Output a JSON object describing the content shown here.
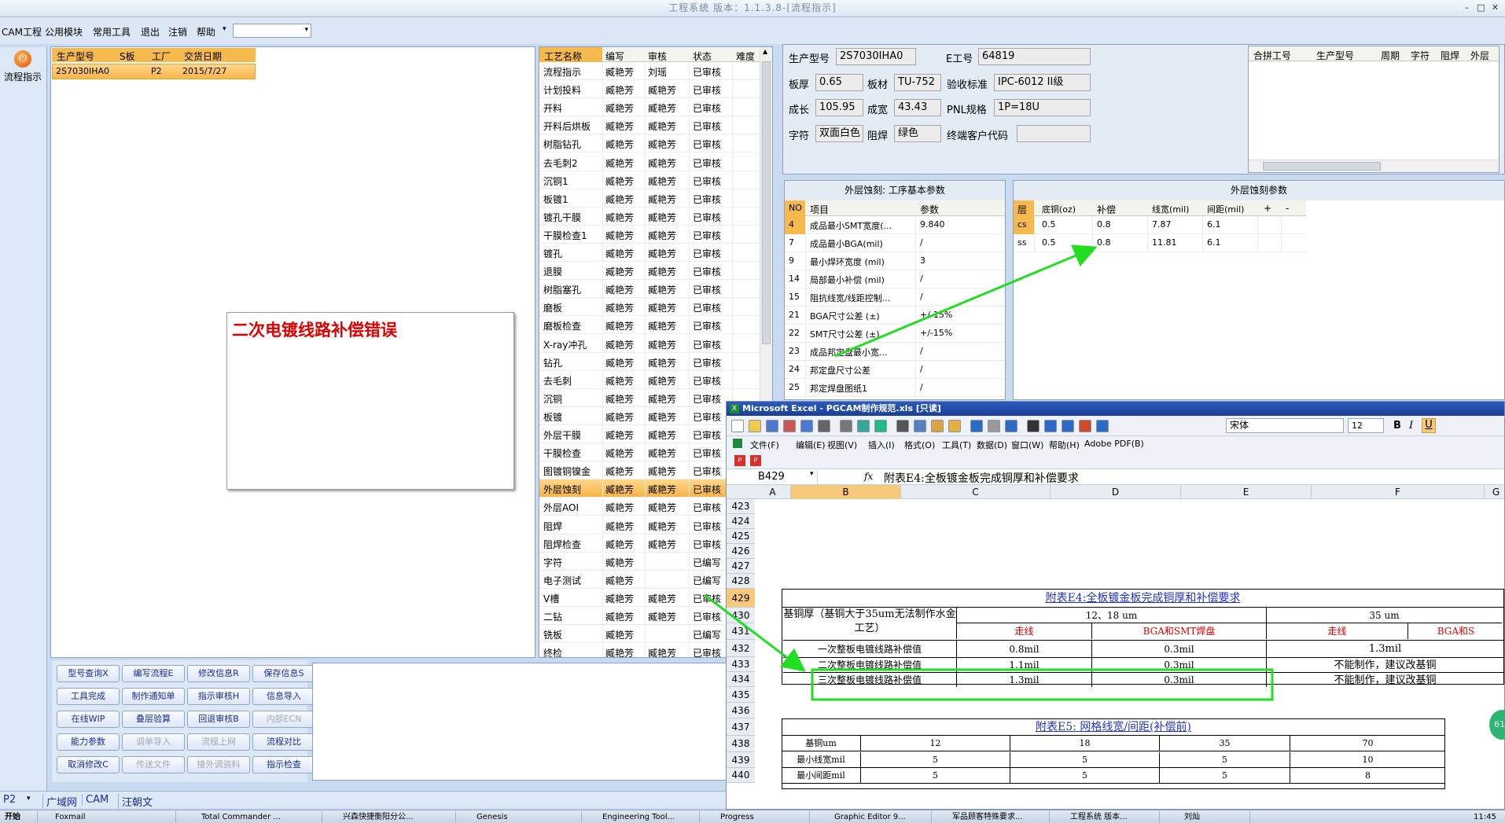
{
  "title": "工程系统 版本：1.1.3.8-[流程指示]",
  "menu": {
    "items": [
      "CAM工程",
      "公用模块",
      "常用工具",
      "退出",
      "注销",
      "帮助"
    ],
    "help_arrow": "▾"
  },
  "leftnav": {
    "flow_label": "流程指示"
  },
  "orders": {
    "headers": [
      "生产型号",
      "S板",
      "工厂",
      "交货日期"
    ],
    "row": [
      "2S7030IHA0",
      "",
      "P2",
      "2015/7/27"
    ]
  },
  "note": {
    "text": "二次电镀线路补偿错误"
  },
  "process": {
    "headers": [
      "工艺名称",
      "编写",
      "审核",
      "状态",
      "难度"
    ],
    "rows": [
      [
        "流程指示",
        "臧艳芳",
        "刘瑶",
        "已审核"
      ],
      [
        "计划投料",
        "臧艳芳",
        "臧艳芳",
        "已审核"
      ],
      [
        "开料",
        "臧艳芳",
        "臧艳芳",
        "已审核"
      ],
      [
        "开料后烘板",
        "臧艳芳",
        "臧艳芳",
        "已审核"
      ],
      [
        "树脂钻孔",
        "臧艳芳",
        "臧艳芳",
        "已审核"
      ],
      [
        "去毛刺2",
        "臧艳芳",
        "臧艳芳",
        "已审核"
      ],
      [
        "沉铜1",
        "臧艳芳",
        "臧艳芳",
        "已审核"
      ],
      [
        "板镀1",
        "臧艳芳",
        "臧艳芳",
        "已审核"
      ],
      [
        "镀孔干膜",
        "臧艳芳",
        "臧艳芳",
        "已审核"
      ],
      [
        "干膜检查1",
        "臧艳芳",
        "臧艳芳",
        "已审核"
      ],
      [
        "镀孔",
        "臧艳芳",
        "臧艳芳",
        "已审核"
      ],
      [
        "退膜",
        "臧艳芳",
        "臧艳芳",
        "已审核"
      ],
      [
        "树脂塞孔",
        "臧艳芳",
        "臧艳芳",
        "已审核"
      ],
      [
        "磨板",
        "臧艳芳",
        "臧艳芳",
        "已审核"
      ],
      [
        "磨板检查",
        "臧艳芳",
        "臧艳芳",
        "已审核"
      ],
      [
        "X-ray冲孔",
        "臧艳芳",
        "臧艳芳",
        "已审核"
      ],
      [
        "钻孔",
        "臧艳芳",
        "臧艳芳",
        "已审核"
      ],
      [
        "去毛刺",
        "臧艳芳",
        "臧艳芳",
        "已审核"
      ],
      [
        "沉铜",
        "臧艳芳",
        "臧艳芳",
        "已审核"
      ],
      [
        "板镀",
        "臧艳芳",
        "臧艳芳",
        "已审核"
      ],
      [
        "外层干膜",
        "臧艳芳",
        "臧艳芳",
        "已审核"
      ],
      [
        "干膜检查",
        "臧艳芳",
        "臧艳芳",
        "已审核"
      ],
      [
        "图镀铜镍金",
        "臧艳芳",
        "臧艳芳",
        "已审核"
      ],
      [
        "外层蚀刻",
        "臧艳芳",
        "臧艳芳",
        "已审核"
      ],
      [
        "外层AOI",
        "臧艳芳",
        "臧艳芳",
        "已审核"
      ],
      [
        "阻焊",
        "臧艳芳",
        "臧艳芳",
        "已审核"
      ],
      [
        "阻焊检查",
        "臧艳芳",
        "臧艳芳",
        "已审核"
      ],
      [
        "字符",
        "臧艳芳",
        "",
        "已编写"
      ],
      [
        "电子测试",
        "臧艳芳",
        "",
        "已编写"
      ],
      [
        "V槽",
        "臧艳芳",
        "臧艳芳",
        "已审核"
      ],
      [
        "二钻",
        "臧艳芳",
        "臧艳芳",
        "已审核"
      ],
      [
        "铣板",
        "臧艳芳",
        "",
        "已编写"
      ],
      [
        "终检",
        "臧艳芳",
        "臧艳芳",
        "已审核"
      ]
    ],
    "selected_index": 23
  },
  "buttons": [
    [
      "型号查询X",
      "编写流程E",
      "修改信息R",
      "保存信息S"
    ],
    [
      "工具完成",
      "制作通知单",
      "指示审核H",
      "信息导入"
    ],
    [
      "在线WIP",
      "叠层验算",
      "回退审核B",
      "内部ECN"
    ],
    [
      "能力参数",
      "调单导入",
      "流程上网",
      "流程对比"
    ],
    [
      "取消修改C",
      "传送文件",
      "接外调资料",
      "指示检查"
    ]
  ],
  "disabled_buttons": [
    "内部ECN",
    "调单导入",
    "流程上网",
    "传送文件",
    "接外调资料"
  ],
  "info": {
    "labels": {
      "model": "生产型号",
      "eno": "E工号",
      "thick": "板厚",
      "mat": "板材",
      "std": "验收标准",
      "len": "成长",
      "wid": "成宽",
      "pnl": "PNL规格",
      "char": "字符",
      "mask": "阻焊",
      "cust": "终端客户代码"
    },
    "values": {
      "model": "2S7030IHA0",
      "eno": "64819",
      "thick": "0.65",
      "mat": "TU-752",
      "std": "IPC-6012 II级",
      "len": "105.95",
      "wid": "43.43",
      "pnl": "1P=18U",
      "char": "双面白色",
      "mask": "绿色",
      "cust": ""
    }
  },
  "merge": {
    "headers": [
      "合拼工号",
      "生产型号",
      "周期",
      "字符",
      "阻焊",
      "外层"
    ]
  },
  "etch_basic": {
    "title": "外层蚀刻: 工序基本参数",
    "headers": [
      "NO",
      "项目",
      "参数"
    ],
    "rows": [
      [
        "4",
        "成品最小SMT宽度(...",
        "9.840"
      ],
      [
        "7",
        "成品最小BGA(mil)",
        "/"
      ],
      [
        "9",
        "最小焊环宽度 (mil)",
        "3"
      ],
      [
        "14",
        "局部最小补偿 (mil)",
        "/"
      ],
      [
        "15",
        "阻抗线宽/线距控制...",
        "/"
      ],
      [
        "21",
        "BGA尺寸公差 (±)",
        "+/-15%"
      ],
      [
        "22",
        "SMT尺寸公差 (±)",
        "+/-15%"
      ],
      [
        "23",
        "成品邦定盘最小宽...",
        "/"
      ],
      [
        "24",
        "邦定盘尺寸公差",
        "/"
      ],
      [
        "25",
        "邦定焊盘图纸1",
        "/"
      ]
    ]
  },
  "etch_params": {
    "title": "外层蚀刻参数",
    "headers": [
      "层",
      "底铜(oz)",
      "补偿",
      "线宽(mil)",
      "间距(mil)",
      "+",
      "-"
    ],
    "rows": [
      [
        "cs",
        "0.5",
        "0.8",
        "7.87",
        "6.1"
      ],
      [
        "ss",
        "0.5",
        "0.8",
        "11.81",
        "6.1"
      ]
    ]
  },
  "excel": {
    "title": "Microsoft Excel - PGCAM制作规范.xls  [只读]",
    "menu": [
      "文件(F)",
      "编辑(E)",
      "视图(V)",
      "插入(I)",
      "格式(O)",
      "工具(T)",
      "数据(D)",
      "窗口(W)",
      "帮助(H)",
      "Adobe PDF(B)"
    ],
    "font": "宋体",
    "size": "12",
    "namebox": "B429",
    "fx": "fx",
    "formula": "附表E4:全板镀金板完成铜厚和补偿要求",
    "cols": [
      "A",
      "B",
      "C",
      "D",
      "E",
      "F",
      "G"
    ],
    "rownums": [
      "423",
      "424",
      "425",
      "426",
      "427",
      "428",
      "429",
      "430",
      "431",
      "432",
      "433",
      "434",
      "435",
      "436",
      "437",
      "438",
      "439",
      "440"
    ],
    "table1_title": "附表E4:全板镀金板完成铜厚和补偿要求",
    "base_cu": "基铜厚（基铜大于35um无法制作水金工艺）",
    "h12": "12、18 um",
    "h35": "35 um",
    "trace": "走线",
    "bga": "BGA和SMT焊盘",
    "trace2": "走线",
    "bga2": "BGA和S",
    "r1": [
      "一次整板电镀线路补偿值",
      "0.8mil",
      "0.3mil",
      "1.3mil"
    ],
    "r2": [
      "二次整板电镀线路补偿值",
      "1.1mil",
      "0.3mil",
      "不能制作，建议改基铜"
    ],
    "r3": [
      "三次整板电镀线路补偿值",
      "1.3mil",
      "0.3mil",
      "不能制作，建议改基铜"
    ],
    "table2_title": "附表E5: 网格线宽/间距(补偿前)",
    "t2_rows": [
      [
        "基铜um",
        "12",
        "18",
        "35",
        "70"
      ],
      [
        "最小线宽mil",
        "5",
        "5",
        "5",
        "10"
      ],
      [
        "最小间距mil",
        "5",
        "5",
        "5",
        "8"
      ]
    ]
  },
  "statusbar": {
    "factory": "P2",
    "items": [
      "广域网",
      "CAM",
      "汪朝文"
    ]
  },
  "badge": "61",
  "taskbar": {
    "start": "开始",
    "items": [
      "Foxmail",
      "Total Commander ...",
      "兴森快捷衡阳分公...",
      "Genesis",
      "Engineering Tool...",
      "Progress",
      "Graphic Editor 9...",
      "军品顾客特殊要求...",
      "工程系统  版本...",
      "刘灿"
    ],
    "clock": "11:45"
  },
  "colors": {
    "accent": "#f5b94e",
    "arrow": "#22dd22",
    "error_text": "#e00000",
    "link": "#2233cc"
  }
}
